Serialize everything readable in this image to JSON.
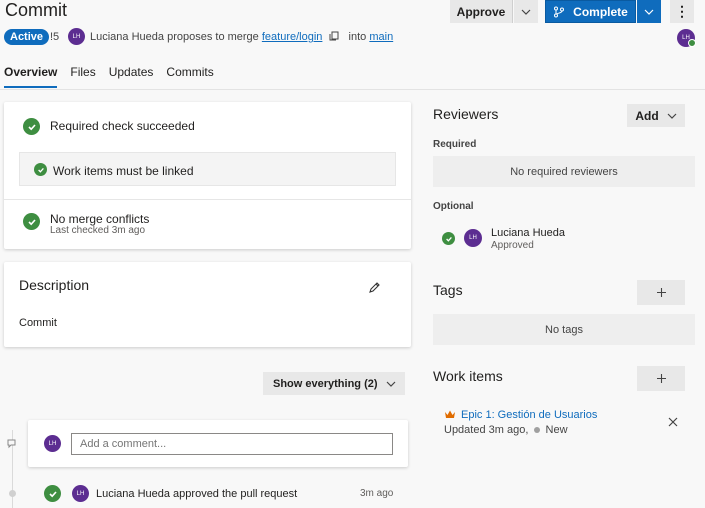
{
  "header": {
    "title": "Commit",
    "approve_label": "Approve",
    "complete_label": "Complete",
    "more_label": "⋮",
    "status": "Active",
    "pr_id": "!5",
    "avatar_initials": "LH",
    "author": "Luciana Hueda",
    "proposes_text": "proposes to merge",
    "source_branch": "feature/login",
    "into_text": "into",
    "target_branch": "main"
  },
  "tabs": [
    {
      "label": "Overview",
      "active": true
    },
    {
      "label": "Files"
    },
    {
      "label": "Updates"
    },
    {
      "label": "Commits"
    }
  ],
  "checks": {
    "required": "Required check succeeded",
    "work_items_linked": "Work items must be linked",
    "merge_title": "No merge conflicts",
    "merge_sub": "Last checked 3m ago"
  },
  "description": {
    "heading": "Description",
    "body": "Commit"
  },
  "show_everything": "Show everything (2)",
  "comment": {
    "avatar_initials": "LH",
    "placeholder": "Add a comment..."
  },
  "timeline": {
    "avatar_initials": "LH",
    "event": "Luciana Hueda approved the pull request",
    "time": "3m ago"
  },
  "reviewers": {
    "heading": "Reviewers",
    "add_label": "Add",
    "required_label": "Required",
    "no_required": "No required reviewers",
    "optional_label": "Optional",
    "reviewer_initials": "LH",
    "reviewer_name": "Luciana Hueda",
    "reviewer_status": "Approved"
  },
  "tags": {
    "heading": "Tags",
    "empty": "No tags"
  },
  "work_items": {
    "heading": "Work items",
    "item_title": "Epic 1: Gestión de Usuarios",
    "item_updated": "Updated 3m ago,",
    "item_state": "New"
  },
  "colors": {
    "accent": "#0f6cbd",
    "success": "#3e8e41",
    "avatar": "#5c2d91",
    "epic": "#e06c00"
  }
}
